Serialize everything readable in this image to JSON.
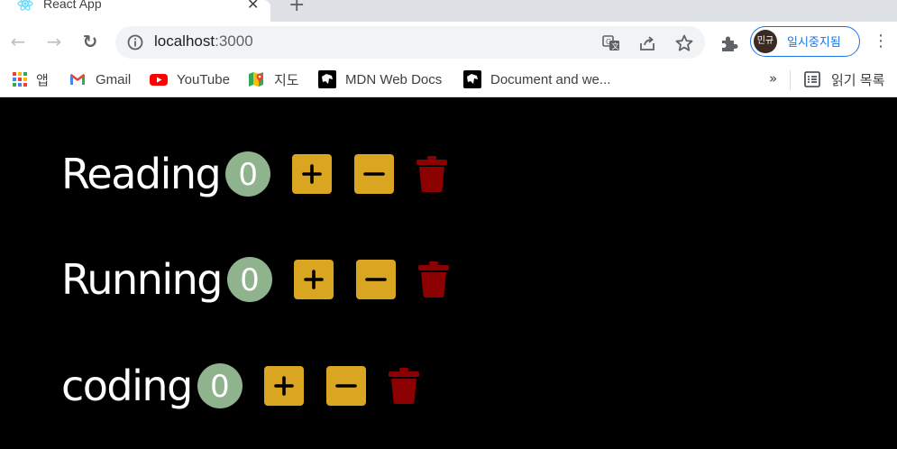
{
  "tab": {
    "title": "React App",
    "close": "✕",
    "new_tab": "+"
  },
  "toolbar": {
    "back": "←",
    "forward": "→",
    "reload": "↻",
    "url_host": "localhost",
    "url_port": ":3000",
    "profile_initials": "민규",
    "profile_status": "일시중지됨",
    "menu": "⋮"
  },
  "bookmarks": {
    "items": [
      {
        "label": "앱",
        "icon": "apps-grid-icon"
      },
      {
        "label": "Gmail",
        "icon": "gmail-icon"
      },
      {
        "label": "YouTube",
        "icon": "youtube-icon"
      },
      {
        "label": "지도",
        "icon": "maps-icon"
      },
      {
        "label": "MDN Web Docs",
        "icon": "mdn-icon"
      },
      {
        "label": "Document and we...",
        "icon": "mdn-icon"
      }
    ],
    "more": "»",
    "reading_list": "읽기 목록"
  },
  "colors": {
    "background": "#000000",
    "counter_badge": "#8fb38d",
    "action_button": "#daa520",
    "trash": "#8b0000"
  },
  "counters": [
    {
      "name": "Reading",
      "count": "0"
    },
    {
      "name": "Running",
      "count": "0"
    },
    {
      "name": "coding",
      "count": "0"
    }
  ]
}
